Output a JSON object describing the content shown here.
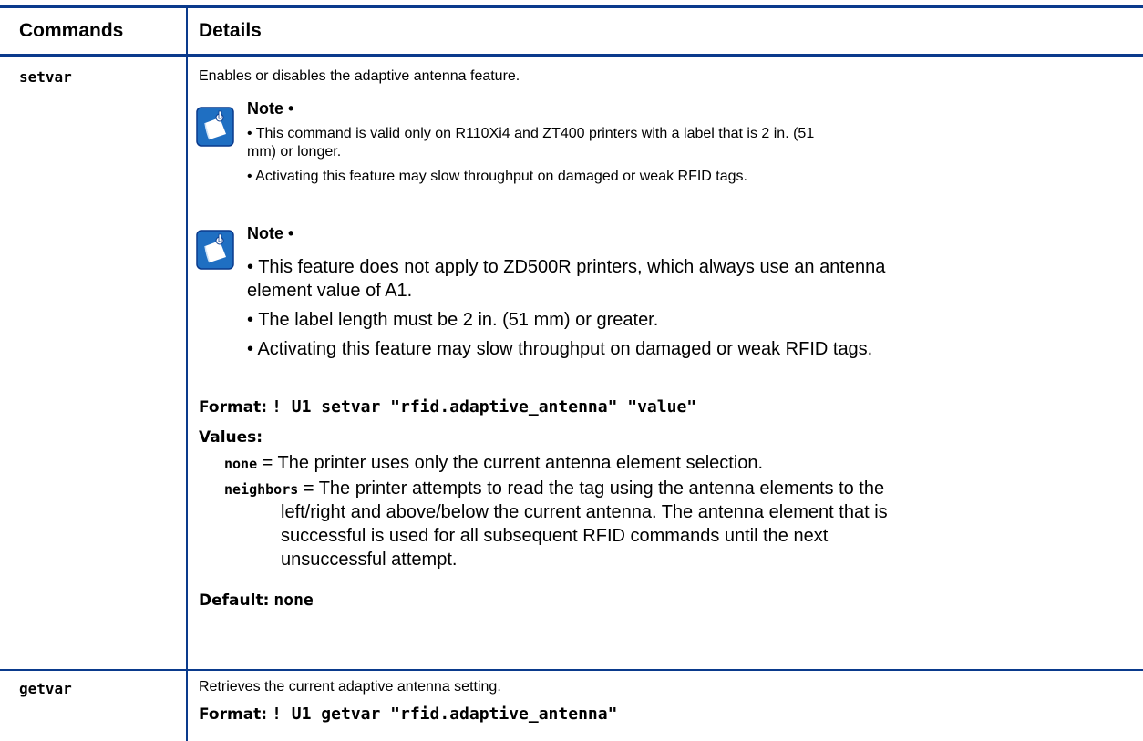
{
  "table": {
    "col_commands": "Commands",
    "col_details": "Details"
  },
  "setvar": {
    "command": "setvar",
    "description": "Enables or disables the adaptive antenna feature.",
    "note1": {
      "title": "Note •",
      "line1a": "• This command is valid only on R110Xi4 and ZT400 printers with a label that is 2 in. (51",
      "line1b": "mm) or longer.",
      "line2": "• Activating this feature may slow throughput on damaged or weak RFID tags."
    },
    "note2": {
      "title": "Note •",
      "line1a": "• This feature does not apply to ZD500R printers, which always use an antenna",
      "line1b": "element value of A1.",
      "line2": "• The label length must be 2 in. (51 mm) or greater.",
      "line3": "• Activating this feature may slow throughput on damaged or weak RFID tags."
    },
    "format_label": "Format:",
    "format_value": "! U1 setvar \"rfid.adaptive_antenna\" \"value\"",
    "values_label": "Values:",
    "values": [
      {
        "key": "none",
        "text": " = The printer uses only the current antenna element selection."
      },
      {
        "key": "neighbors",
        "text": " = The printer attempts to read the tag using the antenna elements to the",
        "cont1": "left/right and above/below the current antenna. The antenna element that is",
        "cont2": "successful is used for all subsequent RFID commands until the next",
        "cont3": "unsuccessful attempt."
      }
    ],
    "default_label": "Default:",
    "default_value": "none"
  },
  "getvar": {
    "command": "getvar",
    "description": "Retrieves the current adaptive antenna setting.",
    "format_label": "Format:",
    "format_value": "! U1 getvar \"rfid.adaptive_antenna\""
  },
  "colors": {
    "rule": "#0a3a8c",
    "note_icon": "#1f6fc2"
  },
  "icons": [
    "note-icon"
  ]
}
